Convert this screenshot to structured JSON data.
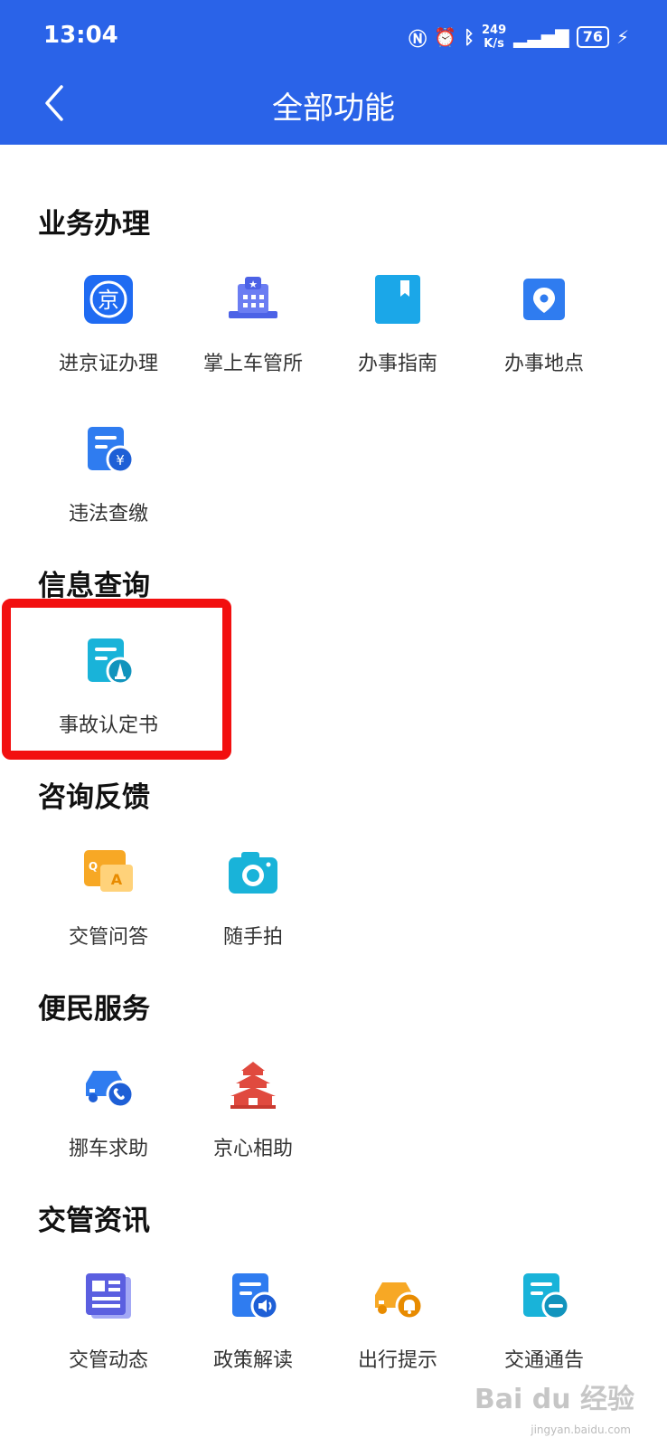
{
  "status": {
    "time": "13:04",
    "speed_value": "249",
    "speed_unit": "K/s",
    "battery": "76",
    "icons": [
      "nfc-icon",
      "alarm-icon",
      "bluetooth-icon",
      "signal-icon",
      "charging-icon"
    ]
  },
  "header": {
    "title": "全部功能",
    "back_icon": "chevron-left-icon"
  },
  "sections": [
    {
      "title": "业务办理",
      "items": [
        {
          "label": "进京证办理",
          "icon": "jing-badge-icon"
        },
        {
          "label": "掌上车管所",
          "icon": "building-icon"
        },
        {
          "label": "办事指南",
          "icon": "bookmark-book-icon"
        },
        {
          "label": "办事地点",
          "icon": "location-pin-icon"
        },
        {
          "label": "违法查缴",
          "icon": "fine-payment-icon"
        }
      ]
    },
    {
      "title": "信息查询",
      "items": [
        {
          "label": "事故认定书",
          "icon": "accident-report-icon"
        }
      ]
    },
    {
      "title": "咨询反馈",
      "items": [
        {
          "label": "交管问答",
          "icon": "qa-chat-icon"
        },
        {
          "label": "随手拍",
          "icon": "camera-icon"
        }
      ]
    },
    {
      "title": "便民服务",
      "items": [
        {
          "label": "挪车求助",
          "icon": "car-phone-icon"
        },
        {
          "label": "京心相助",
          "icon": "temple-icon"
        }
      ]
    },
    {
      "title": "交管资讯",
      "items": [
        {
          "label": "交管动态",
          "icon": "news-icon"
        },
        {
          "label": "政策解读",
          "icon": "policy-audio-icon"
        },
        {
          "label": "出行提示",
          "icon": "car-bell-icon"
        },
        {
          "label": "交通通告",
          "icon": "notice-minus-icon"
        }
      ]
    }
  ],
  "colors": {
    "header": "#2a63e8",
    "highlight": "#f20f0f"
  },
  "watermark": {
    "text": "Bai du 经验",
    "url": "jingyan.baidu.com"
  }
}
